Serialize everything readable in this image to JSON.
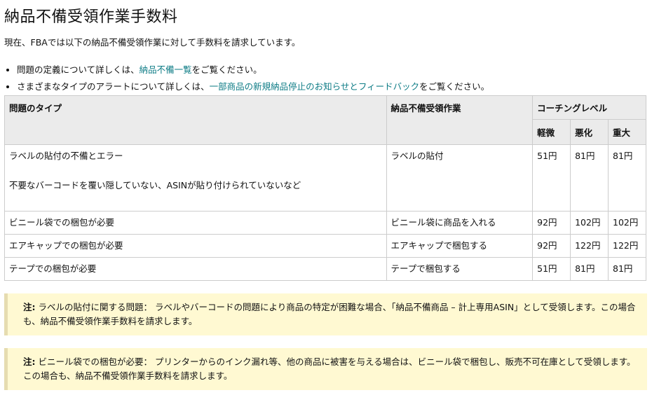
{
  "title": "納品不備受領作業手数料",
  "intro": "現在、FBAでは以下の納品不備受領作業に対して手数料を請求しています。",
  "bullets": [
    {
      "prefix": "問題の定義について詳しくは、",
      "link": "納品不備一覧",
      "suffix": "をご覧ください。"
    },
    {
      "prefix": "さまざまなタイプのアラートについて詳しくは、",
      "link": "一部商品の新規納品停止のお知らせとフィードバック",
      "suffix": "をご覧ください。"
    }
  ],
  "table": {
    "headers": {
      "problem_type": "問題のタイプ",
      "task": "納品不備受領作業",
      "coaching_level": "コーチングレベル",
      "levels": [
        "軽微",
        "悪化",
        "重大"
      ]
    },
    "rows": [
      {
        "problem": "ラベルの貼付の不備とエラー",
        "detail": "不要なバーコードを覆い隠していない、ASINが貼り付けられていないなど",
        "task": "ラベルの貼付",
        "fees": [
          "51円",
          "81円",
          "81円"
        ]
      },
      {
        "problem": "ビニール袋での梱包が必要",
        "detail": "",
        "task": "ビニール袋に商品を入れる",
        "fees": [
          "92円",
          "102円",
          "102円"
        ]
      },
      {
        "problem": "エアキャップでの梱包が必要",
        "detail": "",
        "task": "エアキャップで梱包する",
        "fees": [
          "92円",
          "122円",
          "122円"
        ]
      },
      {
        "problem": "テープでの梱包が必要",
        "detail": "",
        "task": "テープで梱包する",
        "fees": [
          "51円",
          "81円",
          "81円"
        ]
      }
    ]
  },
  "notes": [
    {
      "label": "注:",
      "text": "ラベルの貼付に関する問題： ラベルやバーコードの問題により商品の特定が困難な場合、「納品不備商品 – 計上専用ASIN」として受領します。この場合も、納品不備受領作業手数料を請求します。"
    },
    {
      "label": "注:",
      "text": "ビニール袋での梱包が必要： プリンターからのインク漏れ等、他の商品に被害を与える場合は、ビニール袋で梱包し、販売不可在庫として受領します。この場合も、納品不備受領作業手数料を請求します。"
    }
  ],
  "colors": {
    "link": "#0e7c86",
    "header_bg": "#ebebeb",
    "note_bg": "#fff9d2",
    "border": "#cccccc"
  }
}
